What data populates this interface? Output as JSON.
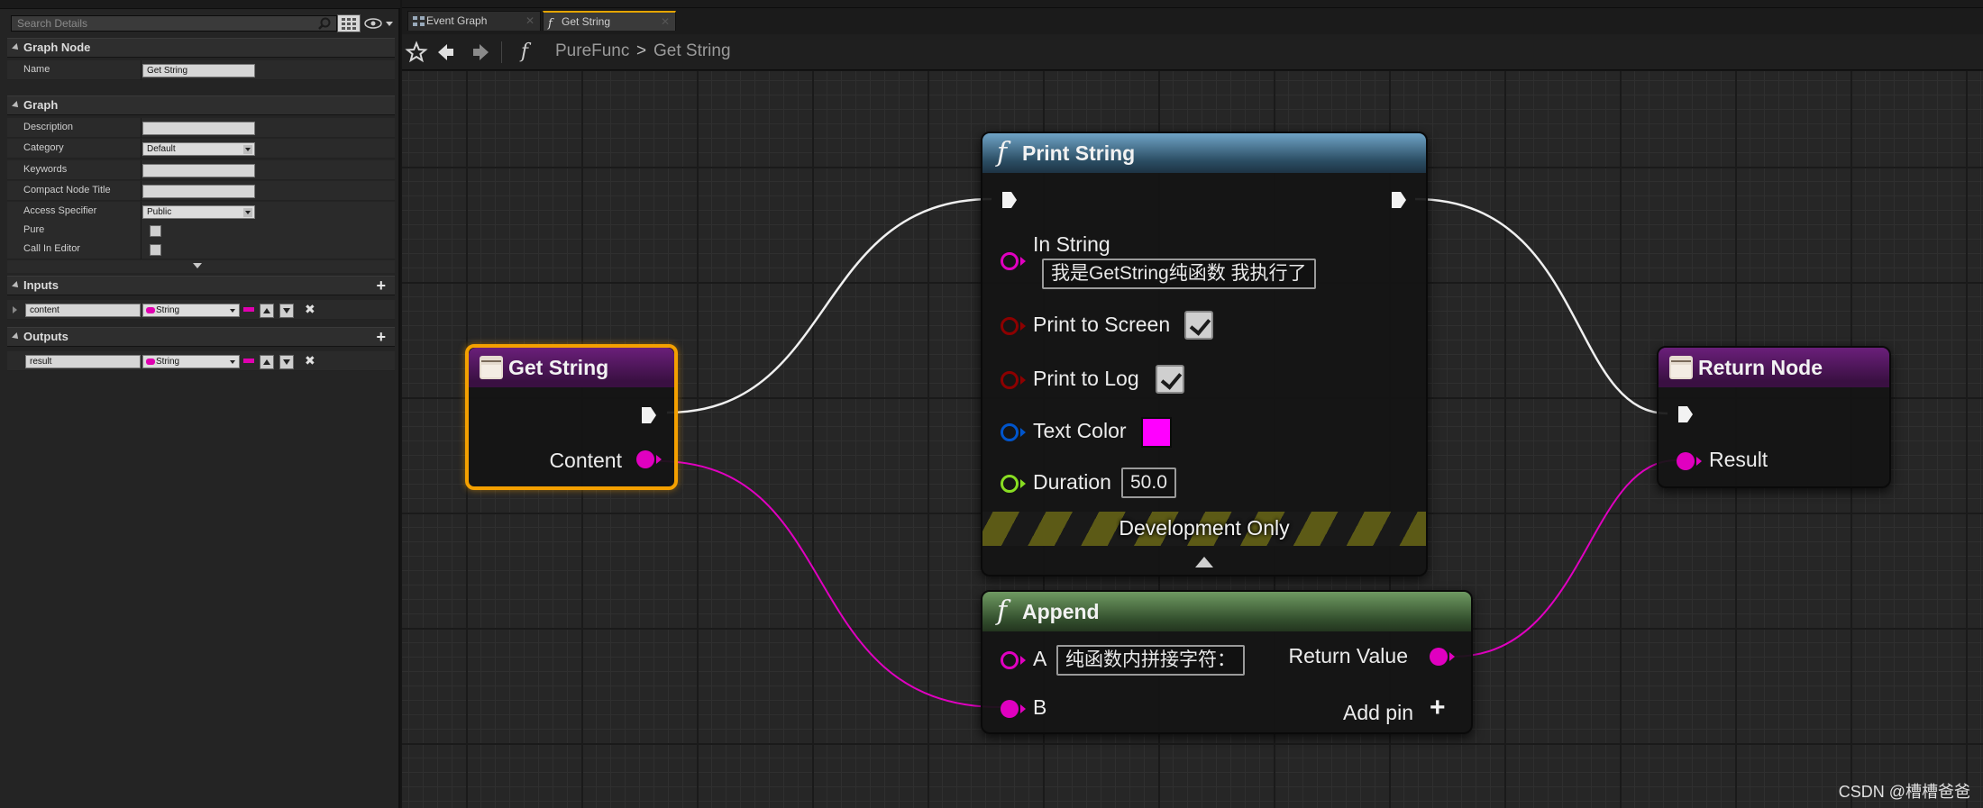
{
  "details": {
    "search_placeholder": "Search Details",
    "graph_node_section": "Graph Node",
    "name_label": "Name",
    "name_value": "Get String",
    "graph_section": "Graph",
    "description_label": "Description",
    "description_value": "",
    "category_label": "Category",
    "category_value": "Default",
    "keywords_label": "Keywords",
    "keywords_value": "",
    "compact_title_label": "Compact Node Title",
    "compact_title_value": "",
    "access_label": "Access Specifier",
    "access_value": "Public",
    "pure_label": "Pure",
    "pure_checked": false,
    "call_in_editor_label": "Call In Editor",
    "call_in_editor_checked": false,
    "inputs_section": "Inputs",
    "inputs": [
      {
        "name": "content",
        "type": "String"
      }
    ],
    "outputs_section": "Outputs",
    "outputs": [
      {
        "name": "result",
        "type": "String"
      }
    ]
  },
  "tabs": [
    {
      "label": "Event Graph",
      "active": false
    },
    {
      "label": "Get String",
      "active": true
    }
  ],
  "breadcrumb": {
    "root": "PureFunc",
    "separator": ">",
    "current": "Get String"
  },
  "nodes": {
    "get_string": {
      "title": "Get String",
      "output_label": "Content"
    },
    "print_string": {
      "title": "Print String",
      "in_string_label": "In String",
      "in_string_value": "我是GetString纯函数 我执行了",
      "print_screen_label": "Print to Screen",
      "print_screen_checked": true,
      "print_log_label": "Print to Log",
      "print_log_checked": true,
      "text_color_label": "Text Color",
      "text_color_value": "#ff00ff",
      "duration_label": "Duration",
      "duration_value": "50.0",
      "dev_only_label": "Development Only"
    },
    "append": {
      "title": "Append",
      "a_label": "A",
      "a_value": "纯函数内拼接字符：",
      "b_label": "B",
      "return_label": "Return Value",
      "add_pin_label": "Add pin"
    },
    "return_node": {
      "title": "Return Node",
      "result_label": "Result"
    }
  },
  "colors": {
    "string_pin": "#e000c0",
    "bool_pin": "#8c0000",
    "struct_pin": "#0055cc",
    "float_pin": "#88dd22",
    "selection": "#f4a000"
  },
  "watermark": "CSDN @槽槽爸爸"
}
